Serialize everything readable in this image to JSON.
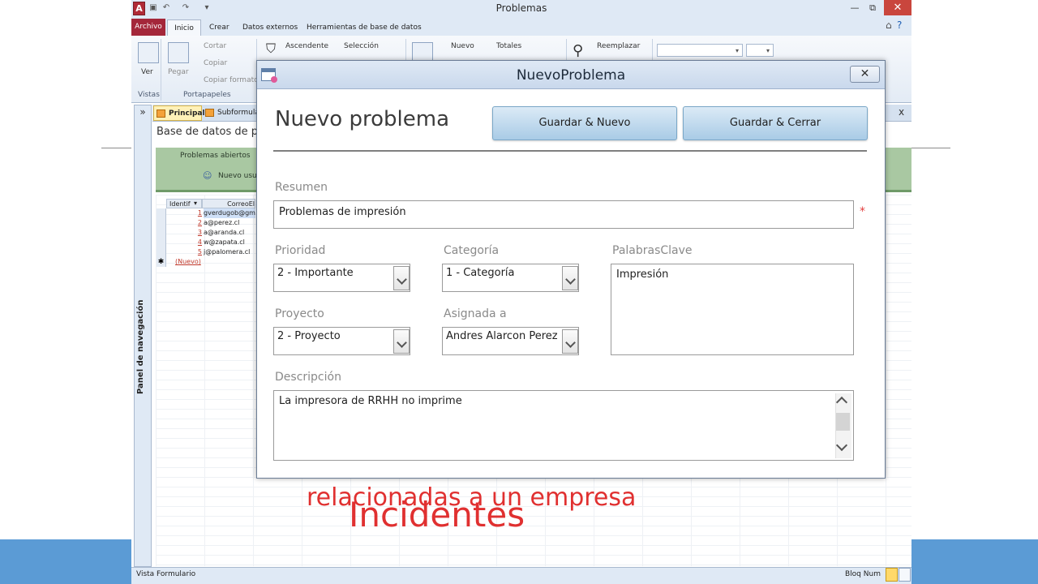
{
  "app": {
    "title": "Problemas",
    "logo_letter": "A",
    "quick_access": [
      "save-icon",
      "undo-icon",
      "redo-icon",
      "customize-icon"
    ],
    "window_controls": {
      "minimize": "—",
      "restore": "⧉",
      "close": "✕"
    }
  },
  "ribbon": {
    "tabs": [
      "Archivo",
      "Inicio",
      "Crear",
      "Datos externos",
      "Herramientas de base de datos"
    ],
    "active_tab": "Inicio",
    "vistas": {
      "ver_label": "Ver",
      "group": "Vistas"
    },
    "portapapeles": {
      "pegar": "Pegar",
      "cortar": "Cortar",
      "copiar": "Copiar",
      "copiar_formato": "Copiar formato",
      "group": "Portapapeles"
    },
    "ordenar": {
      "ascendente": "Ascendente",
      "seleccion": "Selección"
    },
    "registros": {
      "nuevo": "Nuevo",
      "totales": "Totales"
    },
    "buscar": {
      "reemplazar": "Reemplazar"
    }
  },
  "navpane": {
    "label": "Panel de navegación",
    "toggle": "»"
  },
  "doc_tabs": [
    "Principal",
    "Subformula"
  ],
  "doc": {
    "title": "Base de datos de pro",
    "green_links": {
      "problemas_abiertos": "Problemas abiertos",
      "nuevo_usuario": "Nuevo usu"
    },
    "table": {
      "headers": [
        "Identif",
        "CorreoEl"
      ],
      "rows": [
        {
          "id": "1",
          "email": "gverdugob@gm"
        },
        {
          "id": "2",
          "email": "a@perez.cl"
        },
        {
          "id": "3",
          "email": "a@aranda.cl"
        },
        {
          "id": "4",
          "email": "w@zapata.cl"
        },
        {
          "id": "5",
          "email": "j@palomera.cl"
        }
      ],
      "new_row": "(Nuevo)",
      "new_row_marker": "✱"
    },
    "close": "x"
  },
  "status": {
    "left": "Vista Formulario",
    "right": "Bloq Num"
  },
  "dialog": {
    "title": "NuevoProblema",
    "close": "✕",
    "heading": "Nuevo problema",
    "buttons": {
      "save_new": "Guardar & Nuevo",
      "save_close": "Guardar & Cerrar"
    },
    "fields": {
      "resumen": {
        "label": "Resumen",
        "value": "Problemas de impresión",
        "required_mark": "*"
      },
      "prioridad": {
        "label": "Prioridad",
        "value": "2 - Importante"
      },
      "categoria": {
        "label": "Categoría",
        "value": "1 - Categoría"
      },
      "palabras_clave": {
        "label": "PalabrasClave",
        "value": "Impresión"
      },
      "proyecto": {
        "label": "Proyecto",
        "value": "2 - Proyecto"
      },
      "asignada": {
        "label": "Asignada a",
        "value": "Andres Alarcon Perez"
      },
      "descripcion": {
        "label": "Descripción",
        "value": "La impresora de RRHH no imprime"
      }
    }
  },
  "slide": {
    "line1": "relacionadas a un empresa",
    "line2": "Incidentes"
  },
  "colors": {
    "slide_text": "#e03030",
    "accent_band": "#5b9bd5",
    "file_tab": "#a4273a"
  }
}
